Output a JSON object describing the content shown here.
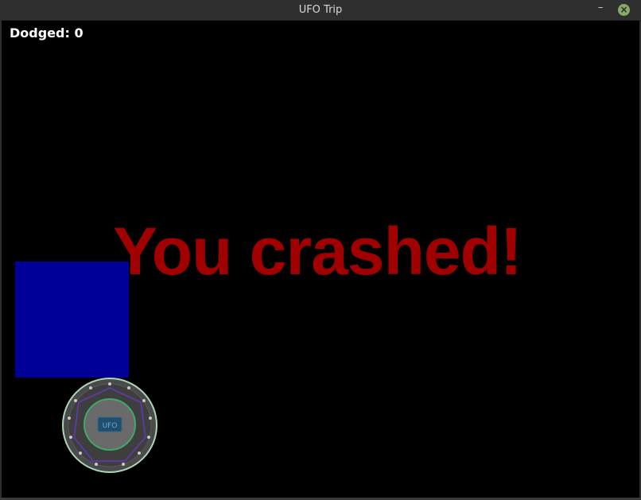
{
  "window": {
    "title": "UFO Trip",
    "minimize_icon": "minimize-icon",
    "close_icon": "close-icon"
  },
  "game": {
    "score_text": "Dodged: 0",
    "message": "You crashed!",
    "ufo_label": "UFO",
    "colors": {
      "background": "#000000",
      "message": "#a00000",
      "obstacle": "#000099",
      "score": "#ffffff"
    }
  }
}
